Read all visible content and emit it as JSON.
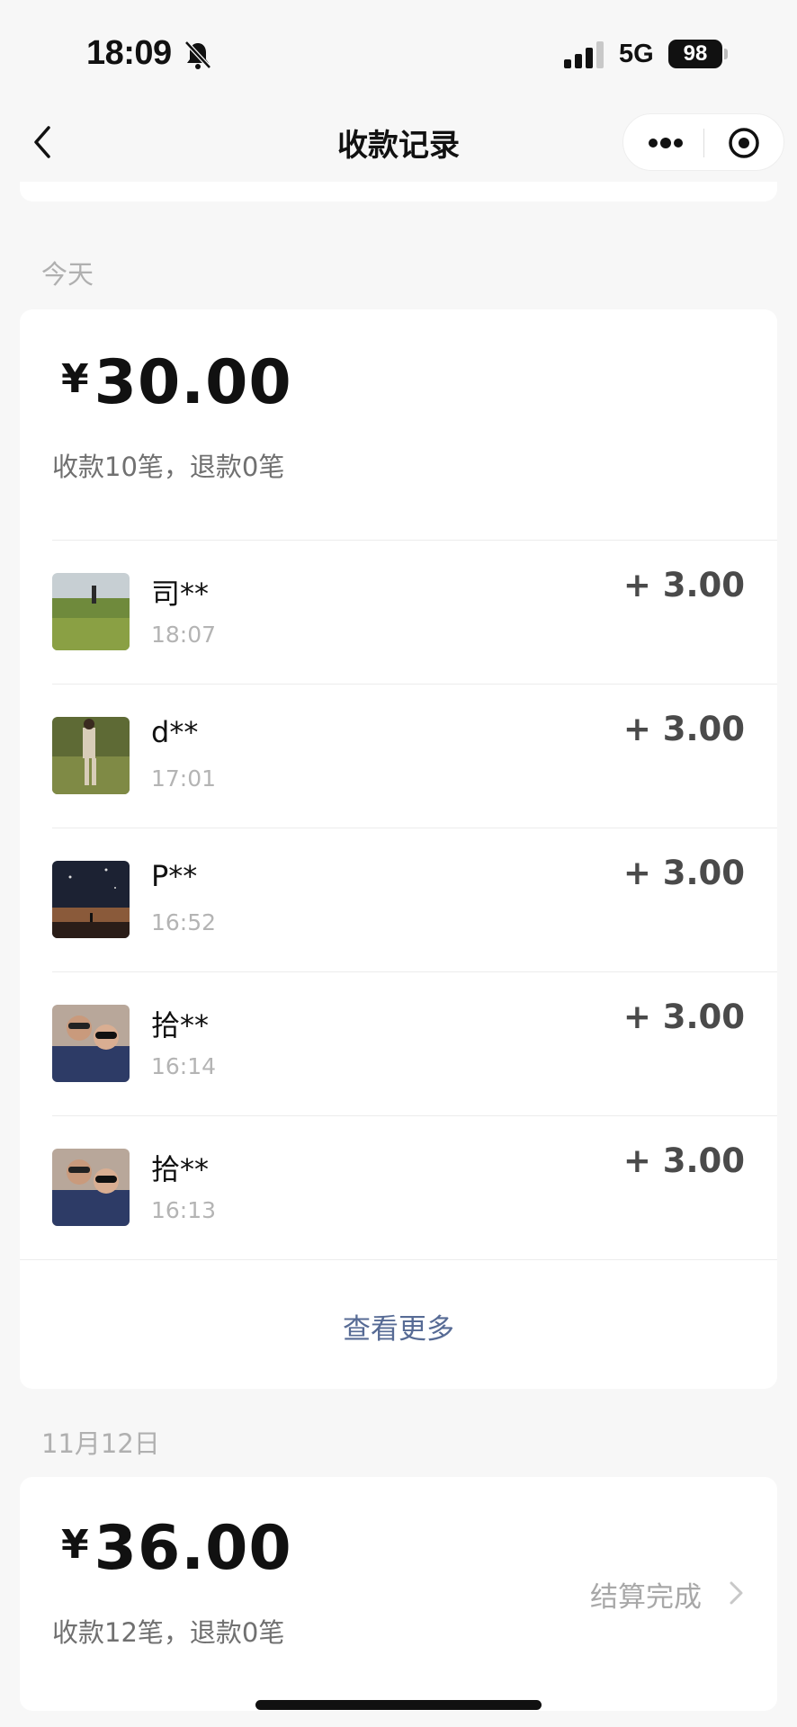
{
  "status_bar": {
    "time": "18:09",
    "network": "5G",
    "battery": "98"
  },
  "nav": {
    "title": "收款记录"
  },
  "today": {
    "date_label": "今天",
    "currency": "¥",
    "total": "30.00",
    "summary": "收款10笔，退款0笔",
    "records": [
      {
        "name": "司**",
        "time": "18:07",
        "amount": "+ 3.00"
      },
      {
        "name": "d**",
        "time": "17:01",
        "amount": "+ 3.00"
      },
      {
        "name": "P**",
        "time": "16:52",
        "amount": "+ 3.00"
      },
      {
        "name": "拾**",
        "time": "16:14",
        "amount": "+ 3.00"
      },
      {
        "name": "拾**",
        "time": "16:13",
        "amount": "+ 3.00"
      }
    ],
    "view_more": "查看更多"
  },
  "nov12": {
    "date_label": "11月12日",
    "currency": "¥",
    "total": "36.00",
    "summary": "收款12笔，退款0笔",
    "status": "结算完成"
  }
}
